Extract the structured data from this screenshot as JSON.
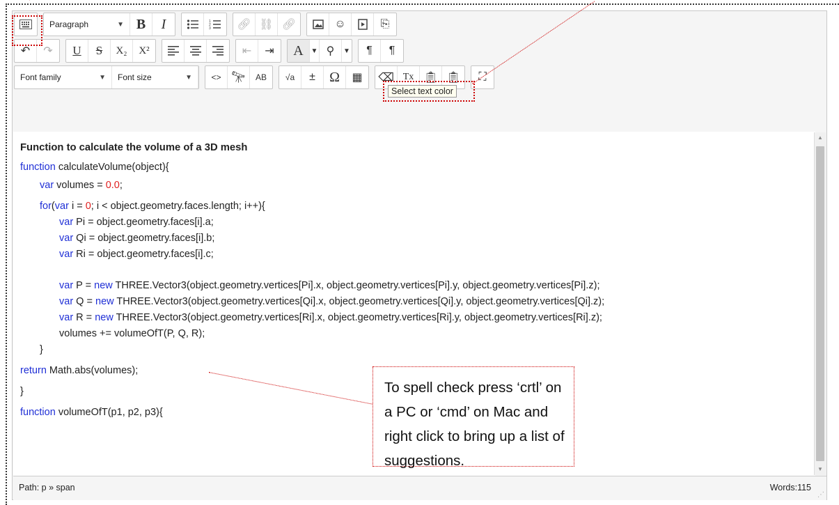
{
  "toolbar": {
    "row1": {
      "format_select": "Paragraph",
      "bold": "B",
      "italic": "I"
    },
    "row2": {
      "underline": "U",
      "strike": "S",
      "subscript": "X₂",
      "superscript": "X²",
      "text_color": "A",
      "pilcrow_ltr": "¶",
      "pilcrow_rtl": "¶"
    },
    "row3": {
      "font_family": "Font family",
      "font_size": "Font size",
      "code_icon": "<>",
      "sqrt_icon": "√a",
      "omega_icon": "Ω",
      "clear_format": "Tx"
    }
  },
  "tooltip": "Select text color",
  "content": {
    "heading": "Function to calculate the volume of a 3D mesh",
    "lines": [
      "function calculateVolume(object){",
      "var volumes = 0.0;",
      "for(var i = 0; i < object.geometry.faces.length; i++){",
      "var Pi = object.geometry.faces[i].a;",
      "var Qi = object.geometry.faces[i].b;",
      "var Ri = object.geometry.faces[i].c;",
      "var P = new THREE.Vector3(object.geometry.vertices[Pi].x, object.geometry.vertices[Pi].y, object.geometry.vertices[Pi].z);",
      "var Q = new THREE.Vector3(object.geometry.vertices[Qi].x, object.geometry.vertices[Qi].y, object.geometry.vertices[Qi].z);",
      "var R = new THREE.Vector3(object.geometry.vertices[Ri].x, object.geometry.vertices[Ri].y, object.geometry.vertices[Ri].z);",
      "volumes += volumeOfT(P, Q, R);",
      "}",
      "return Math.abs(volumes);",
      "}",
      "function volumeOfT(p1, p2, p3){"
    ]
  },
  "statusbar": {
    "path": "Path: p » span",
    "words": "Words:115"
  },
  "callout": "To spell check press ‘crtl’ on a PC or ‘cmd’ on Mac and right click to bring up a list of suggestions.",
  "colors": {
    "keyword": "#1f2fd6",
    "number": "#e02020",
    "annotation": "#cc0000"
  }
}
